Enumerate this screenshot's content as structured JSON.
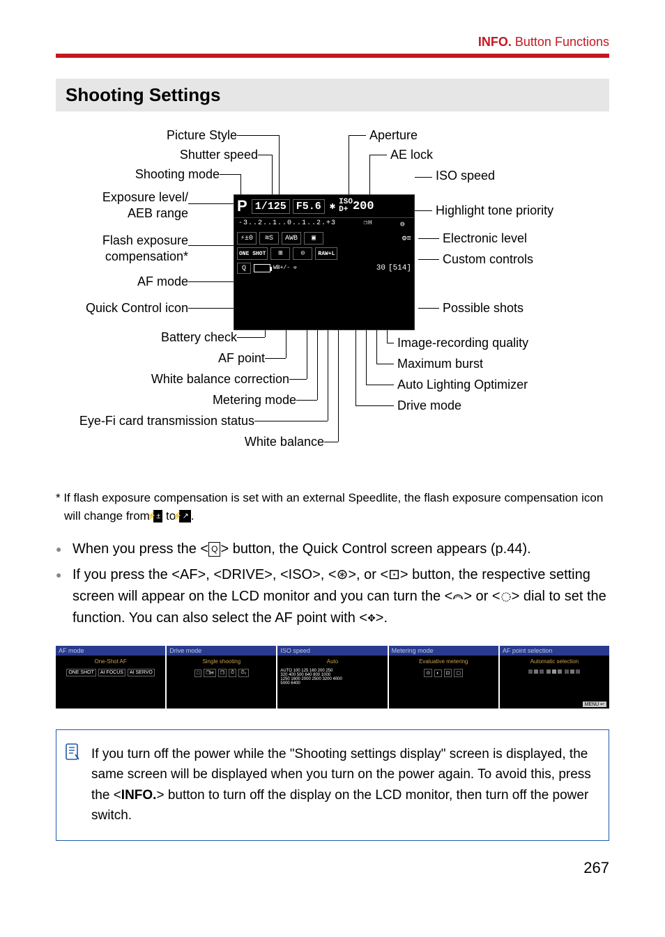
{
  "header": {
    "info_key": "INFO.",
    "rest": " Button Functions"
  },
  "section_title": "Shooting Settings",
  "labels": {
    "picture_style": "Picture Style",
    "shutter_speed": "Shutter speed",
    "shooting_mode": "Shooting mode",
    "exposure_level": "Exposure level/\nAEB range",
    "flash_exp_comp": "Flash exposure\ncompensation*",
    "af_mode": "AF mode",
    "quick_control_icon": "Quick Control icon",
    "battery_check": "Battery check",
    "af_point": "AF point",
    "wb_correction": "White balance correction",
    "metering_mode": "Metering mode",
    "eyefi": "Eye-Fi card transmission status",
    "white_balance": "White balance",
    "aperture": "Aperture",
    "ae_lock": "AE lock",
    "iso_speed": "ISO speed",
    "highlight_tone": "Highlight tone priority",
    "electronic_level": "Electronic level",
    "custom_controls": "Custom controls",
    "possible_shots": "Possible shots",
    "image_quality": "Image-recording quality",
    "max_burst": "Maximum burst",
    "auto_lighting": "Auto Lighting Optimizer",
    "drive_mode": "Drive mode"
  },
  "lcd": {
    "mode": "P",
    "shutter": "1/125",
    "aperture": "F5.6",
    "iso_label": "ISO",
    "iso_dplus": "D+",
    "iso_value": "200",
    "scale": "-3..2..1..0..1..2.+3",
    "flash_comp": "±0",
    "picture_style_code": "S",
    "awb": "AWB",
    "oneshot": "ONE SHOT",
    "raw": "RAW+L",
    "wb_shift": "WB+/-",
    "burst": "30",
    "shots": "[514]"
  },
  "footnote": "* If flash exposure compensation is set with an external Speedlite, the flash exposure compensation icon will change from ",
  "footnote_to": " to ",
  "footnote_end": ".",
  "bullets": {
    "b1_a": "When you press the <",
    "b1_b": "> button, the Quick Control screen appears (p.44).",
    "b2_a": "If you press the <",
    "b2_af": "AF",
    "b2_b": ">, <",
    "b2_drive": "DRIVE",
    "b2_c": ">, <",
    "b2_iso": "ISO",
    "b2_d": ">, <",
    "b2_e": ">, or <",
    "b2_f": "> button, the respective setting screen will appear on the LCD monitor and you can turn the <",
    "b2_g": "> or <",
    "b2_h": "> dial to set the function. You can also select the AF point with <",
    "b2_i": ">."
  },
  "thumbs": {
    "t1": {
      "bar": "AF mode",
      "sub": "One-Shot AF",
      "chips": [
        "ONE SHOT",
        "AI FOCUS",
        "AI SERVO"
      ]
    },
    "t2": {
      "bar": "Drive mode",
      "sub": "Single shooting",
      "chips": [
        "□",
        "❐H",
        "❐",
        "⏱",
        "⏱₂"
      ]
    },
    "t3": {
      "bar": "ISO speed",
      "sub": "Auto",
      "body": "AUTO 100 125 160 200 250\n320 400 500 640 800 1000\n1250 1600 2000 2500 3200 4000\n5000 6400"
    },
    "t4": {
      "bar": "Metering mode",
      "sub": "Evaluative metering",
      "chips": [
        "⊙",
        "◐",
        "⊡",
        "▢"
      ]
    },
    "t5": {
      "bar": "AF point selection",
      "sub": "Automatic selection",
      "body": "grid"
    }
  },
  "note": {
    "a": "If you turn off the power while the \"Shooting settings display\" screen is displayed, the same screen will be displayed when you turn on the power again. To avoid this, press the <",
    "info": "INFO.",
    "b": "> button to turn off the display on the LCD monitor, then turn off the power switch."
  },
  "page_number": "267"
}
